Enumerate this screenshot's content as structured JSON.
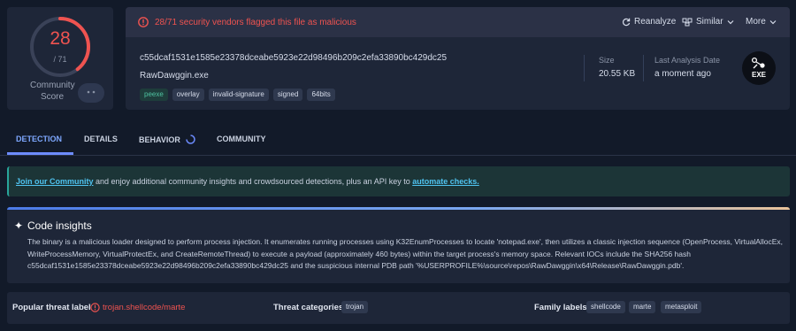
{
  "score": {
    "detections": "28",
    "total": "/ 71",
    "community_label": "Community Score",
    "ratio": 0.394,
    "ring_color": "#ef5350"
  },
  "header": {
    "alert": "28/71 security vendors flagged this file as malicious",
    "reanalyze_label": "Reanalyze",
    "similar_label": "Similar",
    "more_label": "More"
  },
  "file": {
    "hash": "c55dcaf1531e1585e23378dceabe5923e22d98496b209c2efa33890bc429dc25",
    "name": "RawDawggin.exe",
    "tags": [
      "peexe",
      "overlay",
      "invalid-signature",
      "signed",
      "64bits"
    ],
    "size_label": "Size",
    "size_value": "20.55 KB",
    "last_analysis_label": "Last Analysis Date",
    "last_analysis_value": "a moment ago",
    "type_badge": "EXE"
  },
  "tabs": {
    "detection": "DETECTION",
    "details": "DETAILS",
    "behavior": "BEHAVIOR",
    "community": "COMMUNITY"
  },
  "banner": {
    "join_link": "Join our Community",
    "middle_text": " and enjoy additional community insights and crowdsourced detections, plus an API key to ",
    "automate_link": "automate checks."
  },
  "insights": {
    "title": "Code insights",
    "body": "The binary is a malicious loader designed to perform process injection. It enumerates running processes using K32EnumProcesses to locate 'notepad.exe', then utilizes a classic injection sequence (OpenProcess, VirtualAllocEx, WriteProcessMemory, VirtualProtectEx, and CreateRemoteThread) to execute a payload (approximately 460 bytes) within the target process's memory space. Relevant IOCs include the SHA256 hash c55dcaf1531e1585e23378dceabe5923e22d98496b209c2efa33890bc429dc25 and the suspicious internal PDB path '%USERPROFILE%\\source\\repos\\RawDawggin\\x64\\Release\\RawDawggin.pdb'."
  },
  "threat": {
    "popular_label": "Popular threat label",
    "popular_value": "trojan.shellcode/marte",
    "categories_label": "Threat categories",
    "categories": [
      "trojan"
    ],
    "family_label": "Family labels",
    "families": [
      "shellcode",
      "marte",
      "metasploit"
    ]
  }
}
